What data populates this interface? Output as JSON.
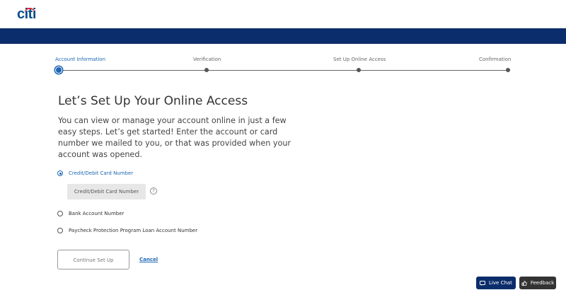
{
  "brand": {
    "logo_text": "citi"
  },
  "stepper": {
    "steps": [
      {
        "label": "Account Information",
        "active": true
      },
      {
        "label": "Verification",
        "active": false
      },
      {
        "label": "Set Up Online Access",
        "active": false
      },
      {
        "label": "Confirmation",
        "active": false
      }
    ]
  },
  "main": {
    "title": "Let’s Set Up Your Online Access",
    "description": "You can view or manage your account online in just a few easy steps. Let’s get started! Enter the account or card number we mailed to you, or that was provided when your account was opened."
  },
  "options": {
    "card": {
      "label": "Credit/Debit Card Number",
      "selected": true
    },
    "card_input_placeholder": "Credit/Debit Card Number",
    "help_symbol": "?",
    "bank": {
      "label": "Bank Account Number",
      "selected": false
    },
    "ppp": {
      "label": "Paycheck Protection Program Loan Account Number",
      "selected": false
    }
  },
  "actions": {
    "continue_label": "Continue Set Up",
    "cancel_label": "Cancel"
  },
  "floating": {
    "live_chat_label": "Live Chat",
    "feedback_label": "Feedback"
  },
  "colors": {
    "band": "#0c2d6b",
    "accent": "#1d66b3",
    "logo_blue": "#0a4d8c",
    "logo_red": "#d81e27"
  }
}
